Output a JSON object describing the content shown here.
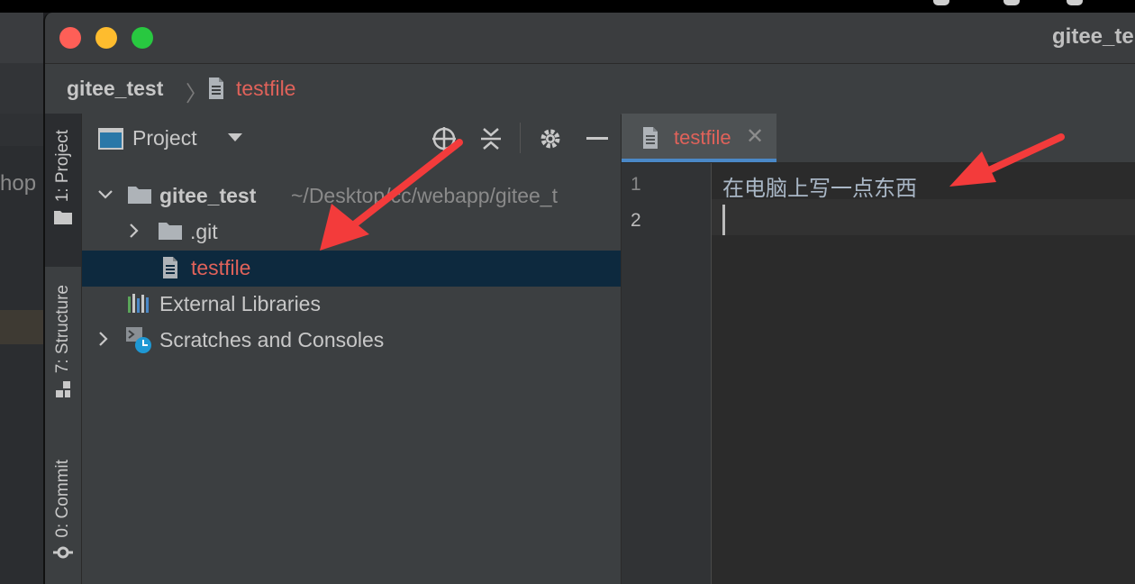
{
  "window": {
    "title": "gitee_te"
  },
  "background_window": {
    "partial_text": "hop"
  },
  "breadcrumb": {
    "root": "gitee_test",
    "file": "testfile"
  },
  "tool_stripe": {
    "tabs": [
      "1: Project",
      "7: Structure",
      "0: Commit"
    ]
  },
  "project_panel": {
    "title": "Project",
    "tree": [
      {
        "label": "gitee_test",
        "detail": "~/Desktop/cc/webapp/gitee_t",
        "icon": "folder-icon",
        "expanded": true
      },
      {
        "label": ".git",
        "icon": "folder-icon",
        "expanded": false
      },
      {
        "label": "testfile",
        "icon": "file-icon",
        "selected": true
      },
      {
        "label": "External Libraries",
        "icon": "libraries-icon"
      },
      {
        "label": "Scratches and Consoles",
        "icon": "scratches-icon",
        "expanded": false
      }
    ]
  },
  "editor": {
    "tab": {
      "label": "testfile"
    },
    "lines": [
      {
        "number": "1",
        "text": "在电脑上写一点东西"
      },
      {
        "number": "2",
        "text": ""
      }
    ]
  },
  "colors": {
    "modified_file": "#e0625a",
    "selection": "#0d293e",
    "tab_underline": "#4a88c7",
    "annotation_arrow": "#f33b3b"
  }
}
